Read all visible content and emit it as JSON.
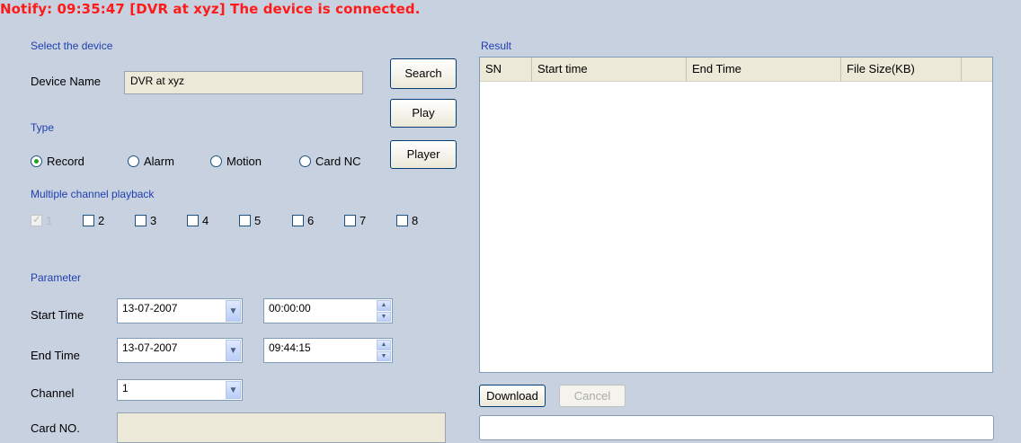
{
  "notify": "Notify:  09:35:47  [DVR at xyz] The device is connected.",
  "device_section": {
    "title": "Select the device",
    "name_label": "Device Name",
    "name_value": "DVR at xyz"
  },
  "buttons": {
    "search": "Search",
    "play": "Play",
    "player": "Player"
  },
  "type_section": {
    "title": "Type",
    "options": [
      "Record",
      "Alarm",
      "Motion",
      "Card NC"
    ],
    "selected": "Record"
  },
  "channel_section": {
    "title": "Multiple channel playback",
    "channels": [
      "1",
      "2",
      "3",
      "4",
      "5",
      "6",
      "7",
      "8"
    ]
  },
  "parameter": {
    "title": "Parameter",
    "start_time_label": "Start Time",
    "start_date": "13-07-2007",
    "start_time": "00:00:00",
    "end_time_label": "End Time",
    "end_date": "13-07-2007",
    "end_time": "09:44:15",
    "channel_label": "Channel",
    "channel_value": "1",
    "card_label": "Card NO.",
    "card_value": ""
  },
  "result": {
    "title": "Result",
    "columns": [
      "SN",
      "Start time",
      "End Time",
      "File Size(KB)"
    ],
    "rows": []
  },
  "actions": {
    "download": "Download",
    "cancel": "Cancel"
  },
  "colors": {
    "background": "#c8d1e0",
    "notify": "#ff1a1a",
    "section_title": "#1f3fb0"
  }
}
